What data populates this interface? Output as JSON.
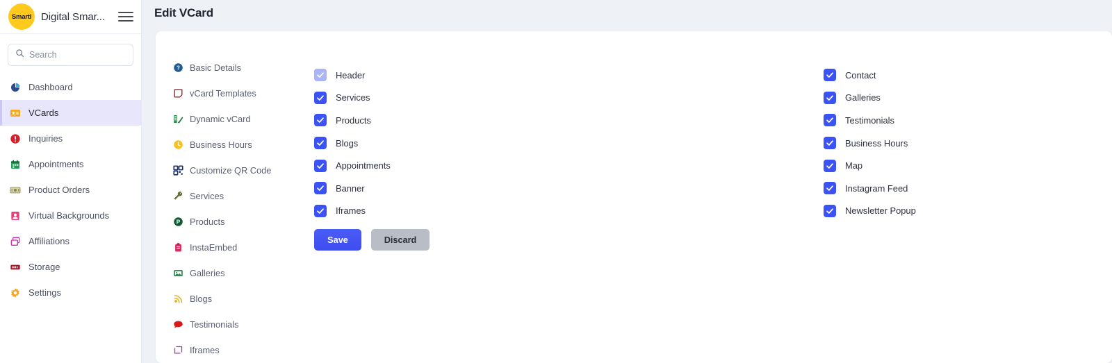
{
  "brand": {
    "logo_text": "Smartl",
    "name": "Digital Smar...",
    "menu_icon": "hamburger-icon"
  },
  "search": {
    "placeholder": "Search",
    "value": "",
    "icon": "search-icon"
  },
  "sidebar": {
    "items": [
      {
        "label": "Dashboard",
        "icon": "pie-chart-icon",
        "active": false
      },
      {
        "label": "VCards",
        "icon": "id-card-icon",
        "active": true
      },
      {
        "label": "Inquiries",
        "icon": "alert-circle-icon",
        "active": false
      },
      {
        "label": "Appointments",
        "icon": "calendar-icon",
        "active": false
      },
      {
        "label": "Product Orders",
        "icon": "money-icon",
        "active": false
      },
      {
        "label": "Virtual Backgrounds",
        "icon": "portrait-icon",
        "active": false
      },
      {
        "label": "Affiliations",
        "icon": "layers-icon",
        "active": false
      },
      {
        "label": "Storage",
        "icon": "server-icon",
        "active": false
      },
      {
        "label": "Settings",
        "icon": "gear-icon",
        "active": false
      }
    ]
  },
  "header": {
    "title": "Edit VCard"
  },
  "submenu": {
    "items": [
      {
        "label": "Basic Details",
        "icon": "question-circle-icon"
      },
      {
        "label": "vCard Templates",
        "icon": "template-icon"
      },
      {
        "label": "Dynamic vCard",
        "icon": "dynamic-card-icon"
      },
      {
        "label": "Business Hours",
        "icon": "clock-icon"
      },
      {
        "label": "Customize QR Code",
        "icon": "qr-code-icon"
      },
      {
        "label": "Services",
        "icon": "wrench-icon"
      },
      {
        "label": "Products",
        "icon": "product-icon"
      },
      {
        "label": "InstaEmbed",
        "icon": "instagram-embed-icon"
      },
      {
        "label": "Galleries",
        "icon": "image-icon"
      },
      {
        "label": "Blogs",
        "icon": "rss-icon"
      },
      {
        "label": "Testimonials",
        "icon": "comment-icon"
      },
      {
        "label": "Iframes",
        "icon": "frame-icon"
      }
    ]
  },
  "sections": {
    "left": [
      {
        "label": "Header",
        "checked": true,
        "disabled": true
      },
      {
        "label": "Services",
        "checked": true,
        "disabled": false
      },
      {
        "label": "Products",
        "checked": true,
        "disabled": false
      },
      {
        "label": "Blogs",
        "checked": true,
        "disabled": false
      },
      {
        "label": "Appointments",
        "checked": true,
        "disabled": false
      },
      {
        "label": "Banner",
        "checked": true,
        "disabled": false
      },
      {
        "label": "Iframes",
        "checked": true,
        "disabled": false
      }
    ],
    "right": [
      {
        "label": "Contact",
        "checked": true,
        "disabled": false
      },
      {
        "label": "Galleries",
        "checked": true,
        "disabled": false
      },
      {
        "label": "Testimonials",
        "checked": true,
        "disabled": false
      },
      {
        "label": "Business Hours",
        "checked": true,
        "disabled": false
      },
      {
        "label": "Map",
        "checked": true,
        "disabled": false
      },
      {
        "label": "Instagram Feed",
        "checked": true,
        "disabled": false
      },
      {
        "label": "Newsletter Popup",
        "checked": true,
        "disabled": false
      }
    ]
  },
  "actions": {
    "save_label": "Save",
    "discard_label": "Discard"
  },
  "colors": {
    "accent": "#3b53f5",
    "accent_muted": "#aab4f7",
    "brand_yellow": "#ffc91d",
    "active_nav_bg": "#e7e6fb",
    "page_bg": "#eef1f6",
    "discard_bg": "#b9bec6"
  }
}
